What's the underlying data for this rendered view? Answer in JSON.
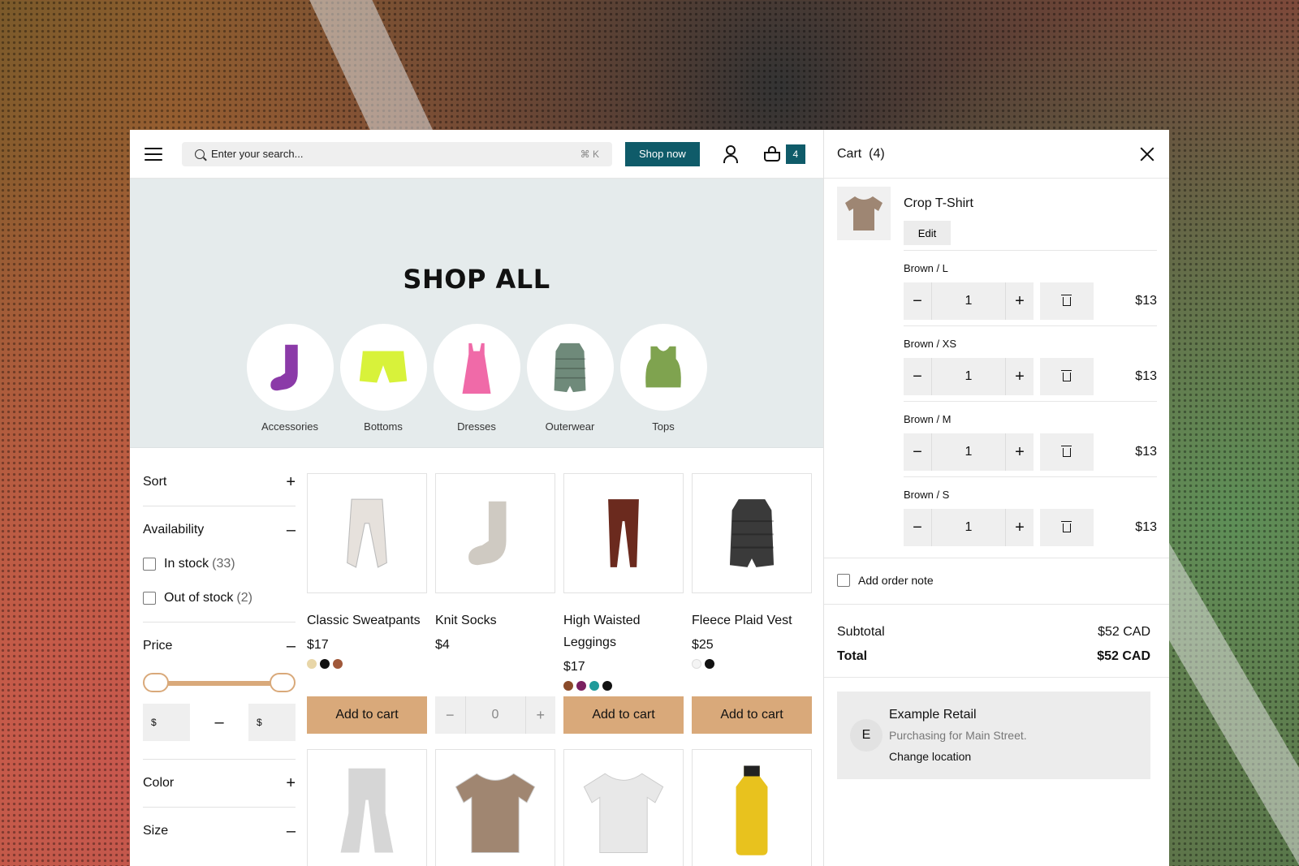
{
  "header": {
    "search_placeholder": "Enter your search...",
    "search_shortcut": "⌘ K",
    "shop_now": "Shop now",
    "cart_count": "4"
  },
  "hero": {
    "title": "SHOP ALL",
    "categories": [
      {
        "label": "Accessories",
        "icon": "sock-icon",
        "color": "#8b3aa8"
      },
      {
        "label": "Bottoms",
        "icon": "shorts-icon",
        "color": "#d8f23a"
      },
      {
        "label": "Dresses",
        "icon": "dress-icon",
        "color": "#f06aa8"
      },
      {
        "label": "Outerwear",
        "icon": "vest-icon",
        "color": "#6f8a7a"
      },
      {
        "label": "Tops",
        "icon": "tank-top-icon",
        "color": "#7fa34f"
      }
    ]
  },
  "filters": {
    "sort": "Sort",
    "availability": "Availability",
    "in_stock": "In stock",
    "in_stock_count": "(33)",
    "out_of_stock": "Out of stock",
    "out_of_stock_count": "(2)",
    "price": "Price",
    "price_min_placeholder": "$",
    "price_max_placeholder": "$",
    "dash": "–",
    "color": "Color",
    "size": "Size",
    "accent": "#d9a97a"
  },
  "products": [
    {
      "name": "Classic Sweatpants",
      "price": "$17",
      "swatches": [
        "#e8d6a8",
        "#111111",
        "#a0583a"
      ],
      "button": "Add to cart",
      "icon": "sweatpants-icon",
      "color": "#e6e1dc"
    },
    {
      "name": "Knit Socks",
      "price": "$4",
      "swatches": [],
      "stepper_value": "0",
      "icon": "sock-icon",
      "color": "#cfcac2"
    },
    {
      "name": "High Waisted Leggings",
      "price": "$17",
      "swatches": [
        "#8a4a2a",
        "#7a2060",
        "#1f9a9a",
        "#111111"
      ],
      "button": "Add to cart",
      "icon": "leggings-icon",
      "color": "#6b2a1e"
    },
    {
      "name": "Fleece Plaid Vest",
      "price": "$25",
      "swatches": [
        "#f4f4f4",
        "#111111"
      ],
      "button": "Add to cart",
      "icon": "vest-icon",
      "color": "#3a3a3a"
    }
  ],
  "products_row2": [
    {
      "icon": "flare-pants-icon",
      "color": "#d6d6d6"
    },
    {
      "icon": "tshirt-icon",
      "color": "#a08671"
    },
    {
      "icon": "tshirt-icon",
      "color": "#e8e8e8"
    },
    {
      "icon": "bottle-icon",
      "color": "#e8c21e"
    }
  ],
  "cart": {
    "title": "Cart",
    "count": "(4)",
    "item_title": "Crop T-Shirt",
    "edit": "Edit",
    "variants": [
      {
        "label": "Brown / L",
        "qty": "1",
        "price": "$13"
      },
      {
        "label": "Brown / XS",
        "qty": "1",
        "price": "$13"
      },
      {
        "label": "Brown / M",
        "qty": "1",
        "price": "$13"
      },
      {
        "label": "Brown / S",
        "qty": "1",
        "price": "$13"
      }
    ],
    "order_note": "Add order note",
    "subtotal_label": "Subtotal",
    "subtotal": "$52 CAD",
    "total_label": "Total",
    "total": "$52 CAD",
    "retail_initial": "E",
    "retail_name": "Example Retail",
    "retail_sub": "Purchasing for Main Street.",
    "retail_link": "Change location"
  }
}
